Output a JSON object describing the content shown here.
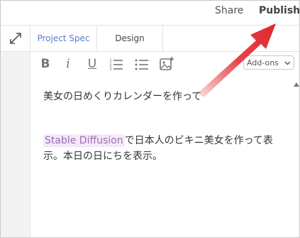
{
  "header": {
    "share_label": "Share",
    "publish_label": "Publish"
  },
  "tabs": [
    {
      "label": "Project Spec",
      "active": true
    },
    {
      "label": "Design",
      "active": false
    }
  ],
  "toolbar": {
    "bold_label": "B",
    "italic_label": "i",
    "underline_label": "U",
    "addons_label": "Add-ons",
    "icons": [
      "bold-icon",
      "italic-icon",
      "underline-icon",
      "ordered-list-icon",
      "bullet-list-icon",
      "image-icon"
    ]
  },
  "editor": {
    "line1": "美女の日めくりカレンダーを作って",
    "highlight_text": "Stable Diffusion",
    "line2": "で日本人のビキニ美女を作って表示。本日の日にちを表示。"
  },
  "colors": {
    "tab_active": "#5b7bd6",
    "highlight_bg": "#f4eaf7",
    "highlight_text": "#9a6db5",
    "arrow": "#e0262b"
  }
}
